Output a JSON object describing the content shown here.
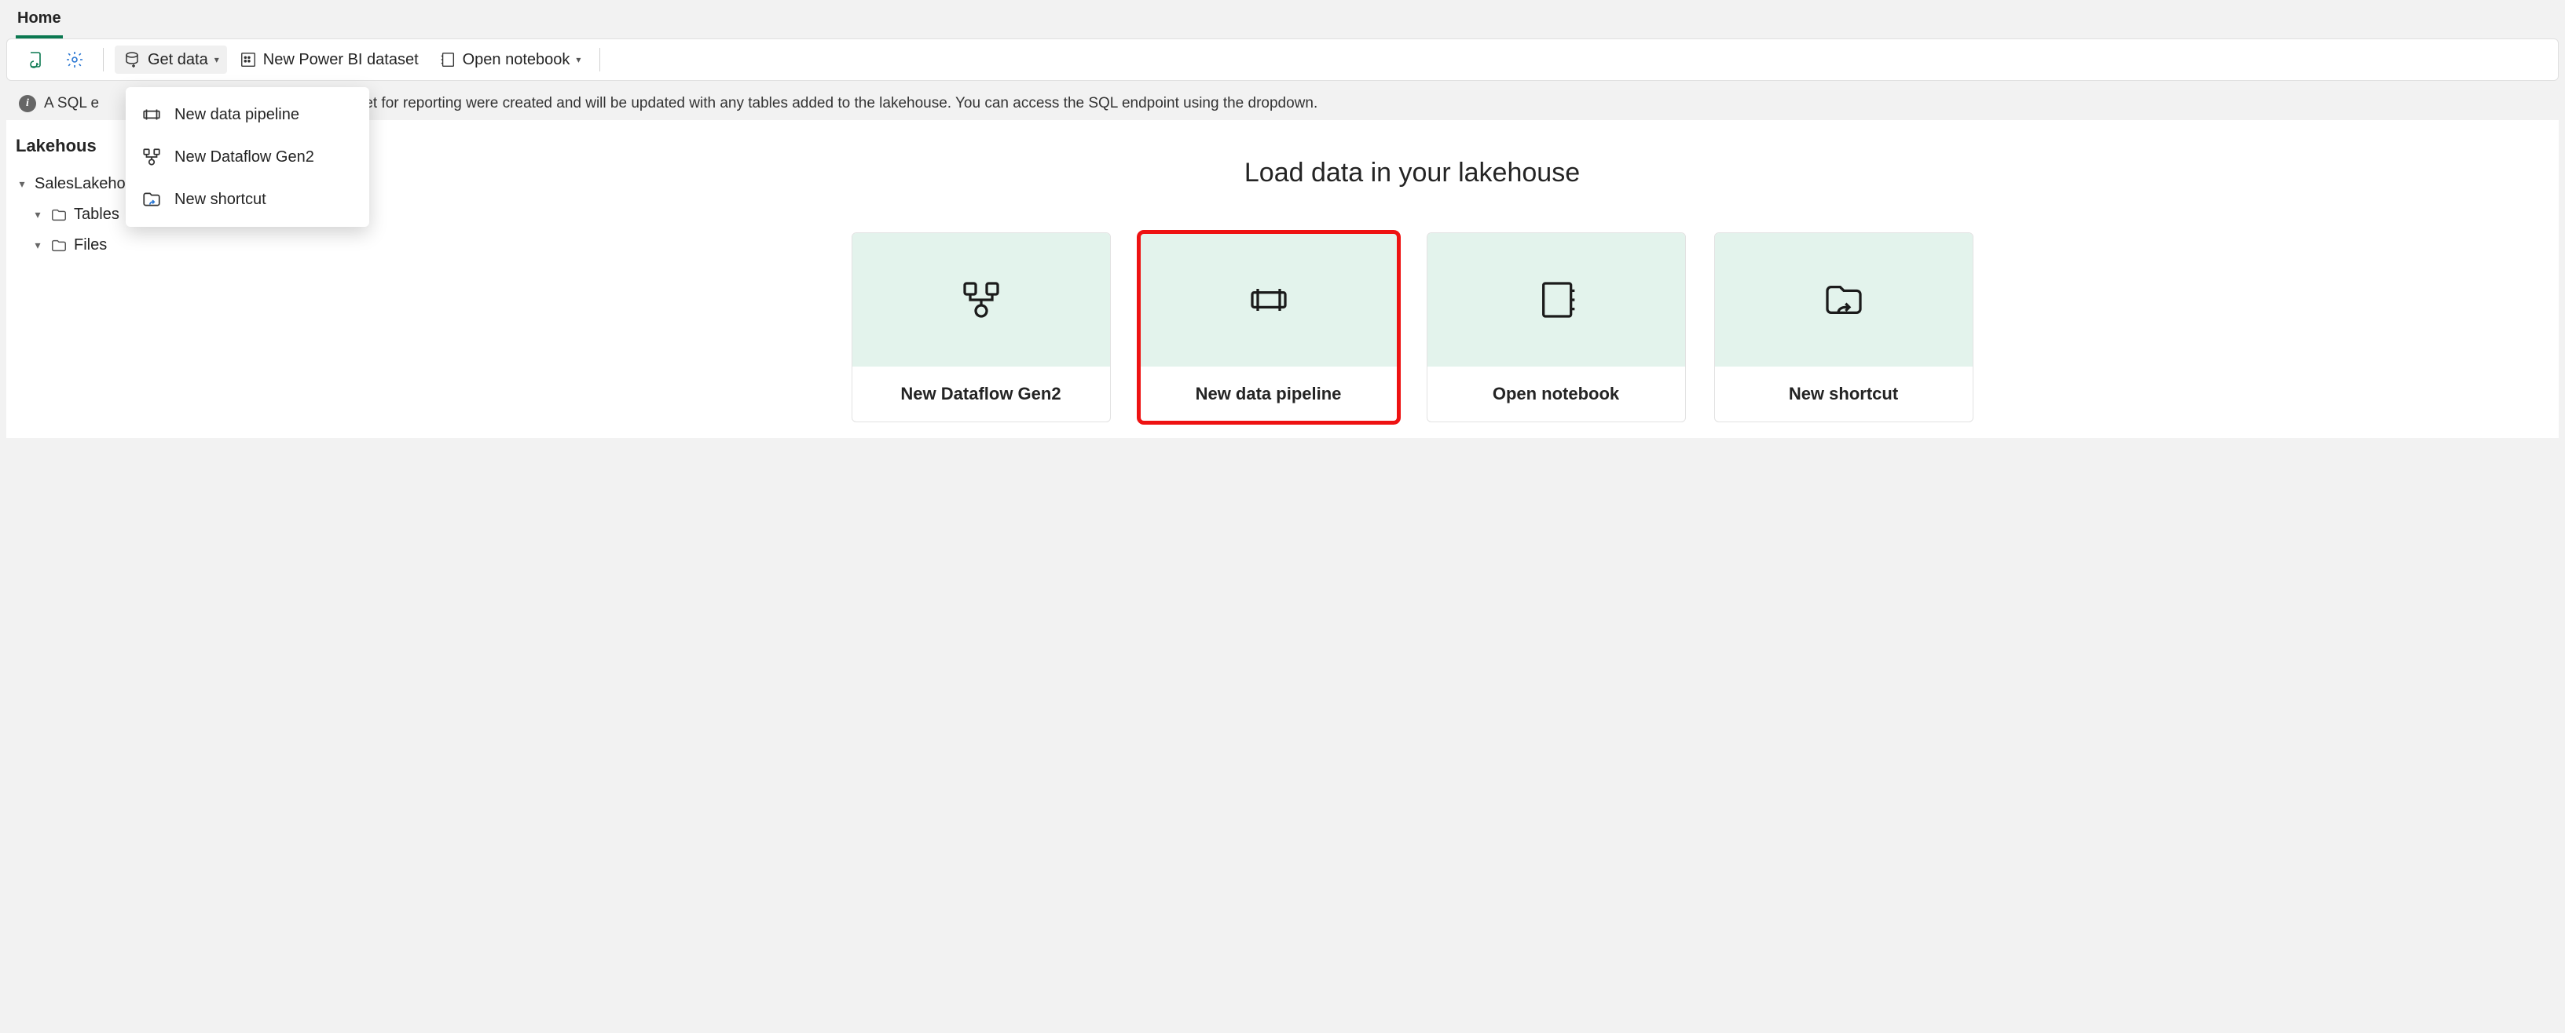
{
  "tabs": {
    "home": "Home"
  },
  "toolbar": {
    "get_data": "Get data",
    "new_dataset": "New Power BI dataset",
    "open_notebook": "Open notebook"
  },
  "get_data_menu": {
    "pipeline": "New data pipeline",
    "dataflow": "New Dataflow Gen2",
    "shortcut": "New shortcut"
  },
  "info": {
    "text_partial": "A SQL e",
    "text_rest": "efault dataset for reporting were created and will be updated with any tables added to the lakehouse. You can access the SQL endpoint using the dropdown."
  },
  "explorer": {
    "header_partial": "Lakehous",
    "root": "SalesLakehouse",
    "tables": "Tables",
    "files": "Files"
  },
  "main": {
    "title": "Load data in your lakehouse",
    "cards": {
      "dataflow": "New Dataflow Gen2",
      "pipeline": "New data pipeline",
      "notebook": "Open notebook",
      "shortcut": "New shortcut"
    }
  }
}
